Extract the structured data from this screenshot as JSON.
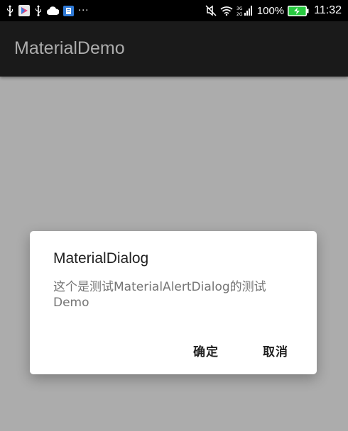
{
  "status_bar": {
    "left_icons": [
      "usb-icon",
      "play-store-icon",
      "usb-icon",
      "cloud-icon",
      "app-notification-icon",
      "more-notifications-icon"
    ],
    "more_indicator": "···",
    "battery_percent": "100%",
    "time": "11:32",
    "right_icons": [
      "mute-icon",
      "wifi-icon",
      "signal-icon",
      "battery-charging-icon"
    ]
  },
  "app_bar": {
    "title": "MaterialDemo"
  },
  "dialog": {
    "title": "MaterialDialog",
    "message": "这个是测试MaterialAlertDialog的测试Demo",
    "positive_button": "确定",
    "negative_button": "取消"
  },
  "colors": {
    "scrim": "#acacac",
    "app_bar": "#1a1a1a",
    "status_bar": "#000000",
    "battery": "#27c93f",
    "dialog_bg": "#ffffff"
  }
}
